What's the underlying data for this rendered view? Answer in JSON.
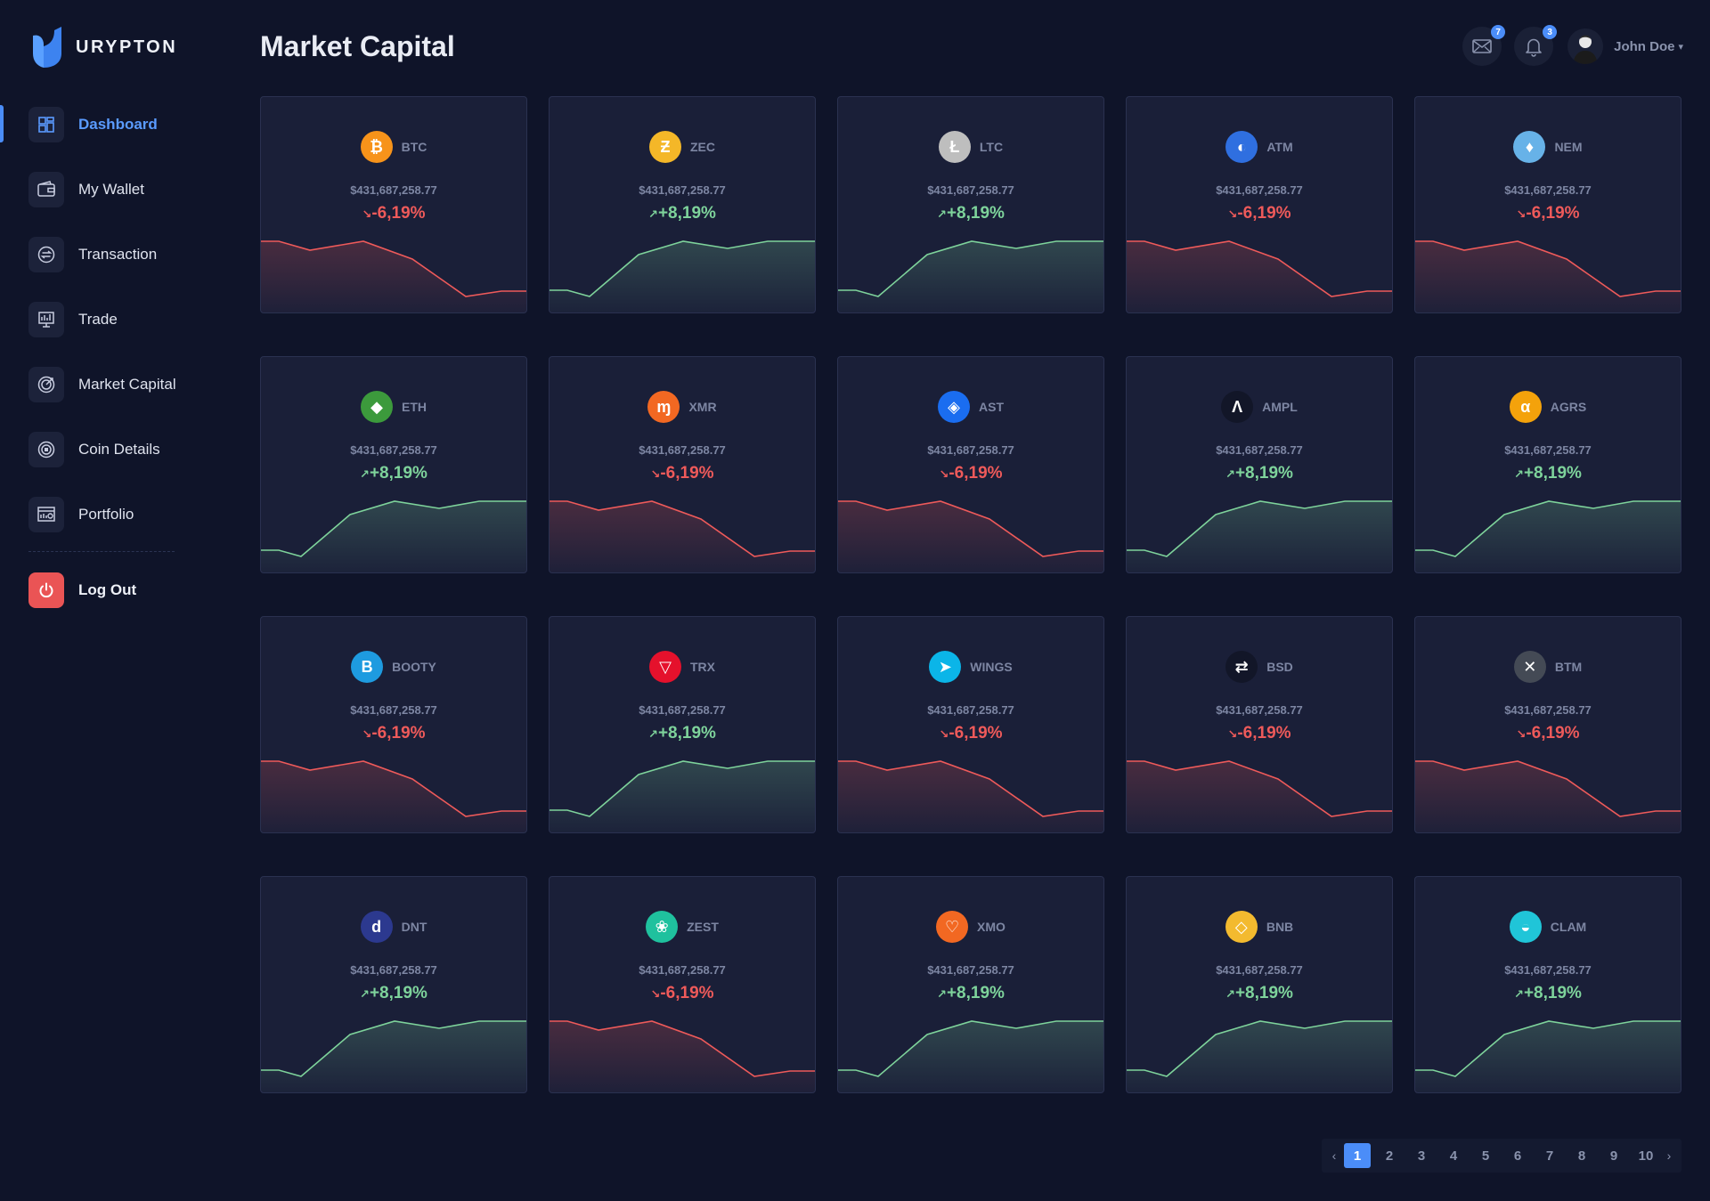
{
  "app": {
    "name": "URYPTON"
  },
  "header": {
    "title": "Market Capital",
    "mail_badge": "7",
    "bell_badge": "3",
    "user_name": "John Doe"
  },
  "sidebar": {
    "items": [
      {
        "label": "Dashboard",
        "icon": "dashboard-icon",
        "active": true
      },
      {
        "label": "My Wallet",
        "icon": "wallet-icon",
        "active": false
      },
      {
        "label": "Transaction",
        "icon": "transaction-icon",
        "active": false
      },
      {
        "label": "Trade",
        "icon": "trade-icon",
        "active": false
      },
      {
        "label": "Market Capital",
        "icon": "market-capital-icon",
        "active": false
      },
      {
        "label": "Coin Details",
        "icon": "coin-details-icon",
        "active": false
      },
      {
        "label": "Portfolio",
        "icon": "portfolio-icon",
        "active": false
      }
    ],
    "logout_label": "Log Out"
  },
  "colors": {
    "up": "#7ed39b",
    "down": "#ee5a5a",
    "accent": "#4b8df8"
  },
  "coins": [
    {
      "symbol": "BTC",
      "value": "$431,687,258.77",
      "change": "-6,19%",
      "trend": "down",
      "icon": "bitcoin-icon",
      "color": "#f7931a",
      "glyph": "₿"
    },
    {
      "symbol": "ZEC",
      "value": "$431,687,258.77",
      "change": "+8,19%",
      "trend": "up",
      "icon": "zcash-icon",
      "color": "#f4b728",
      "glyph": "Ƶ"
    },
    {
      "symbol": "LTC",
      "value": "$431,687,258.77",
      "change": "+8,19%",
      "trend": "up",
      "icon": "litecoin-icon",
      "color": "#bebebe",
      "glyph": "Ł"
    },
    {
      "symbol": "ATM",
      "value": "$431,687,258.77",
      "change": "-6,19%",
      "trend": "down",
      "icon": "atm-icon",
      "color": "#2f6fe0",
      "glyph": "◐"
    },
    {
      "symbol": "NEM",
      "value": "$431,687,258.77",
      "change": "-6,19%",
      "trend": "down",
      "icon": "nem-icon",
      "color": "#67b2e8",
      "glyph": "♦"
    },
    {
      "symbol": "ETH",
      "value": "$431,687,258.77",
      "change": "+8,19%",
      "trend": "up",
      "icon": "ethereum-icon",
      "color": "#3c9a3c",
      "glyph": "◆"
    },
    {
      "symbol": "XMR",
      "value": "$431,687,258.77",
      "change": "-6,19%",
      "trend": "down",
      "icon": "monero-icon",
      "color": "#f26822",
      "glyph": "ɱ"
    },
    {
      "symbol": "AST",
      "value": "$431,687,258.77",
      "change": "-6,19%",
      "trend": "down",
      "icon": "airswap-icon",
      "color": "#1a6df0",
      "glyph": "◈"
    },
    {
      "symbol": "AMPL",
      "value": "$431,687,258.77",
      "change": "+8,19%",
      "trend": "up",
      "icon": "ampleforth-icon",
      "color": "#121628",
      "glyph": "Λ"
    },
    {
      "symbol": "AGRS",
      "value": "$431,687,258.77",
      "change": "+8,19%",
      "trend": "up",
      "icon": "agoras-icon",
      "color": "#f4a20b",
      "glyph": "α"
    },
    {
      "symbol": "BOOTY",
      "value": "$431,687,258.77",
      "change": "-6,19%",
      "trend": "down",
      "icon": "booty-icon",
      "color": "#1e9be0",
      "glyph": "B"
    },
    {
      "symbol": "TRX",
      "value": "$431,687,258.77",
      "change": "+8,19%",
      "trend": "up",
      "icon": "tron-icon",
      "color": "#e5112c",
      "glyph": "▽"
    },
    {
      "symbol": "WINGS",
      "value": "$431,687,258.77",
      "change": "-6,19%",
      "trend": "down",
      "icon": "wings-icon",
      "color": "#0bb5e8",
      "glyph": "➤"
    },
    {
      "symbol": "BSD",
      "value": "$431,687,258.77",
      "change": "-6,19%",
      "trend": "down",
      "icon": "bsd-icon",
      "color": "#121628",
      "glyph": "⇄"
    },
    {
      "symbol": "BTM",
      "value": "$431,687,258.77",
      "change": "-6,19%",
      "trend": "down",
      "icon": "bytom-icon",
      "color": "#444a55",
      "glyph": "✕"
    },
    {
      "symbol": "DNT",
      "value": "$431,687,258.77",
      "change": "+8,19%",
      "trend": "up",
      "icon": "district0x-icon",
      "color": "#2c398f",
      "glyph": "d"
    },
    {
      "symbol": "ZEST",
      "value": "$431,687,258.77",
      "change": "-6,19%",
      "trend": "down",
      "icon": "zest-icon",
      "color": "#1fc19e",
      "glyph": "❀"
    },
    {
      "symbol": "XMO",
      "value": "$431,687,258.77",
      "change": "+8,19%",
      "trend": "up",
      "icon": "xmo-icon",
      "color": "#f26822",
      "glyph": "♡"
    },
    {
      "symbol": "BNB",
      "value": "$431,687,258.77",
      "change": "+8,19%",
      "trend": "up",
      "icon": "binance-icon",
      "color": "#f3ba2f",
      "glyph": "◇"
    },
    {
      "symbol": "CLAM",
      "value": "$431,687,258.77",
      "change": "+8,19%",
      "trend": "up",
      "icon": "clam-icon",
      "color": "#20c5d8",
      "glyph": "◒"
    }
  ],
  "pagination": {
    "pages": [
      "1",
      "2",
      "3",
      "4",
      "5",
      "6",
      "7",
      "8",
      "9",
      "10"
    ],
    "current": "1",
    "prev": "‹",
    "next": "›"
  }
}
